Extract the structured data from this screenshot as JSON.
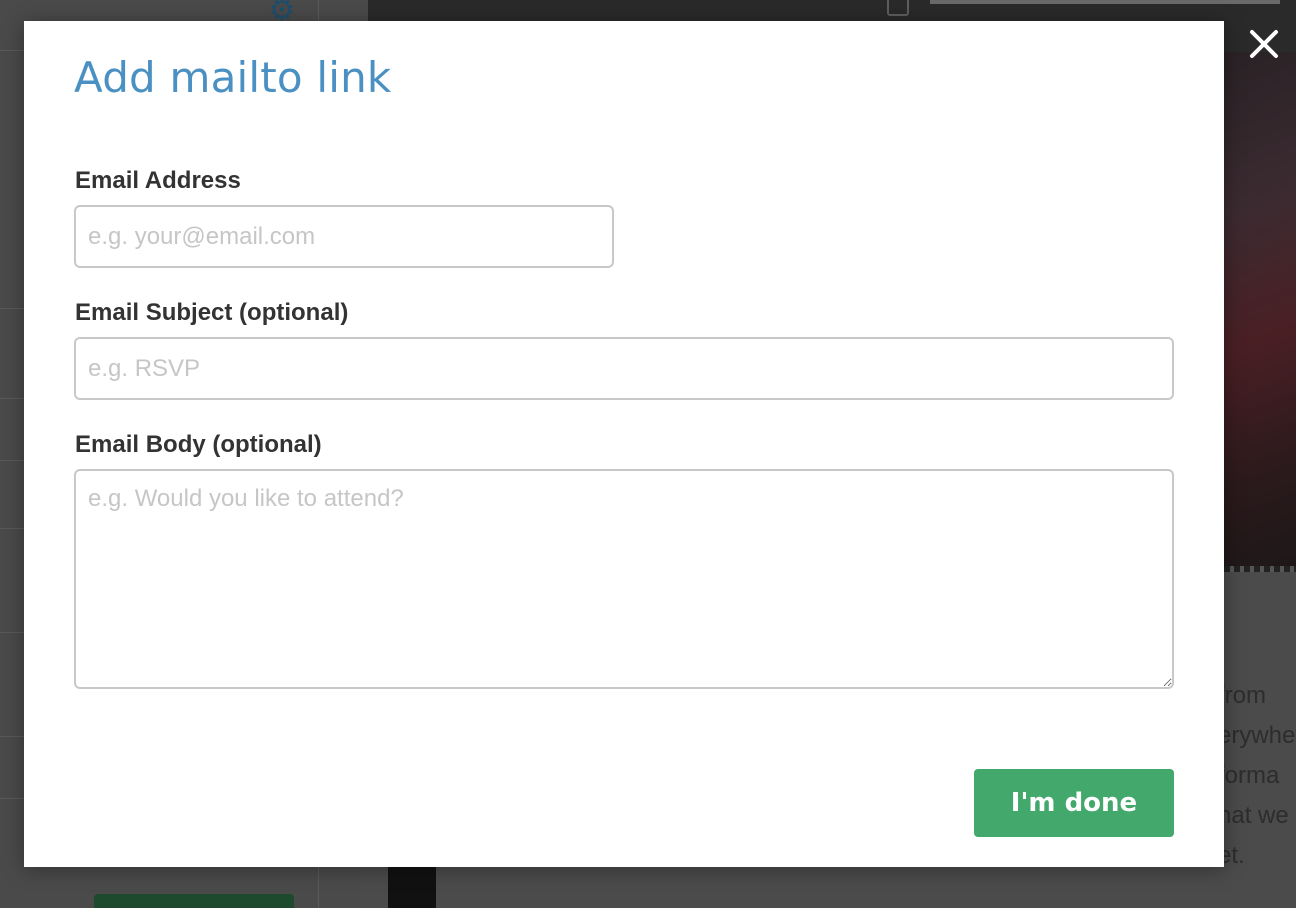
{
  "background": {
    "text_lines": [
      "from",
      "erywhe",
      "forma",
      "hat we",
      "et."
    ]
  },
  "modal": {
    "title": "Add mailto link",
    "email_address": {
      "label": "Email Address",
      "placeholder": "e.g. your@email.com",
      "value": ""
    },
    "email_subject": {
      "label": "Email Subject (optional)",
      "placeholder": "e.g. RSVP",
      "value": ""
    },
    "email_body": {
      "label": "Email Body (optional)",
      "placeholder": "e.g. Would you like to attend?",
      "value": ""
    },
    "done_label": "I'm done",
    "close_icon": "close-icon"
  },
  "colors": {
    "title": "#4a90c2",
    "done_button": "#43a86b",
    "overlay": "#3a3a3a"
  }
}
